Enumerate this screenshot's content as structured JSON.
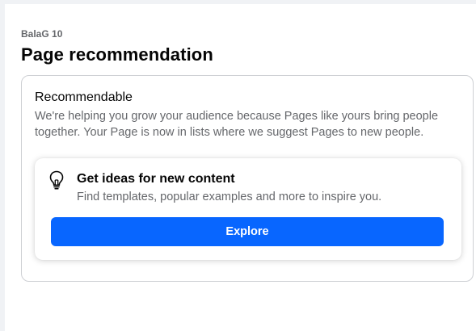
{
  "header": {
    "breadcrumb": "BalaG 10",
    "title": "Page recommendation"
  },
  "card": {
    "title": "Recommendable",
    "description": "We're helping you grow your audience because Pages like yours bring people together. Your Page is now in lists where we suggest Pages to new people."
  },
  "ideas": {
    "icon": "lightbulb-icon",
    "title": "Get ideas for new content",
    "description": "Find templates, popular examples and more to inspire you.",
    "button_label": "Explore"
  },
  "colors": {
    "accent": "#0866ff",
    "secondary_text": "#65676b",
    "page_background": "#f0f2f5"
  }
}
